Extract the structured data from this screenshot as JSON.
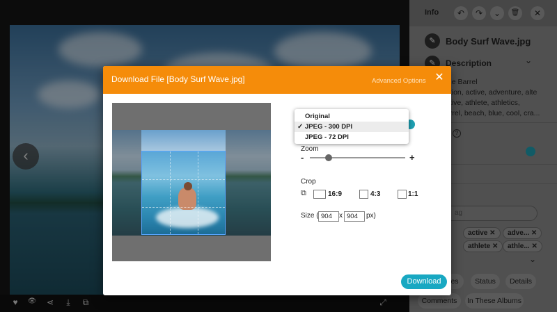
{
  "modal": {
    "title": "Download File [Body Surf Wave.jpg]",
    "advanced_options": "Advanced Options",
    "zoom_label": "Zoom",
    "zoom_minus": "-",
    "zoom_plus": "+",
    "zoom_level": 0.2,
    "crop_label": "Crop",
    "crop_options": [
      "16:9",
      "4:3",
      "1:1"
    ],
    "size_prefix": "Size (",
    "size_width": "904",
    "size_x": "x",
    "size_height": "904",
    "size_suffix": "px)",
    "download_label": "Download"
  },
  "format_dropdown": {
    "options": [
      "Original",
      "JPEG - 300 DPI",
      "JPEG - 72 DPI"
    ],
    "selected": "JPEG - 300 DPI",
    "check": "✓"
  },
  "panel": {
    "header": "Info",
    "file_name": "Body Surf Wave.jpg",
    "description_label": "Description",
    "description_lines": [
      "the Barrel",
      "ation, active, adventure, alte",
      "ative, athlete, athletics,",
      "arrel, beach, blue, cool, cra..."
    ],
    "tags": [
      "active",
      "adve...",
      "athlete",
      "athle..."
    ],
    "tag_input_placeholder": "ag",
    "tab_buttons": [
      "Status",
      "Details",
      "Comments",
      "In These Albums"
    ],
    "partial_tab": "es"
  },
  "icons": {
    "prev": "‹",
    "expand": "⤢",
    "undo": "↶",
    "redo": "↷",
    "chevron_down": "⌄",
    "trash": "🗑",
    "close": "✕",
    "pencil": "✎",
    "help": "?",
    "heart": "♥",
    "eye": "👁",
    "share": "⋖",
    "download": "⤓",
    "crop": "⧉"
  },
  "colors": {
    "accent_orange": "#f58c0a",
    "accent_teal": "#18a8c2"
  }
}
